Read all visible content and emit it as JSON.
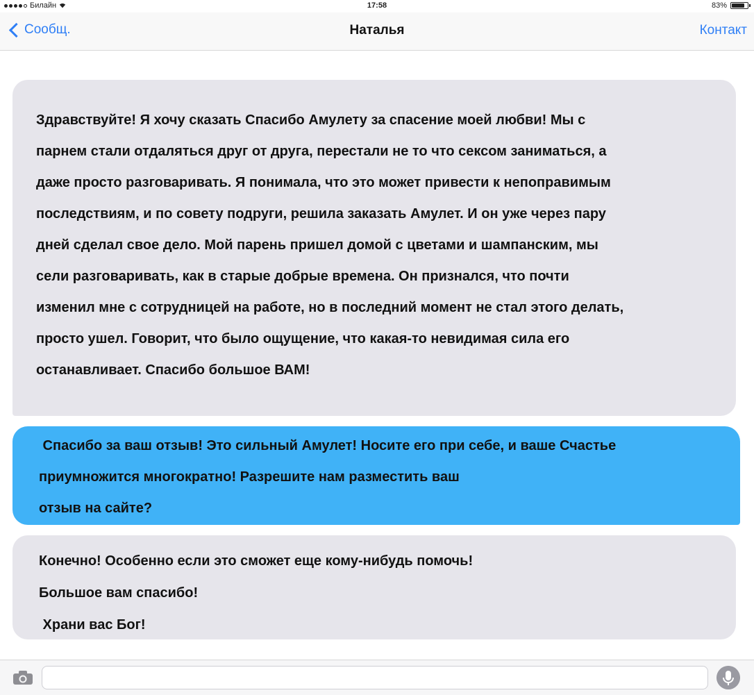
{
  "status_bar": {
    "carrier": "Билайн",
    "time": "17:58",
    "battery_text": "83%",
    "battery_level": 0.83
  },
  "nav": {
    "back_label": "Сообщ.",
    "title": "Наталья",
    "contact_label": "Контакт"
  },
  "messages": [
    {
      "direction": "incoming",
      "lines": [
        "Здравствуйте! Я хочу сказать Спасибо Амулету за спасение моей любви! Мы с",
        "парнем стали отдаляться друг от друга, перестали не то что сексом заниматься, а",
        "даже просто разговаривать. Я понимала, что это может привести к непоправимым",
        "последствиям, и  по совету подруги, решила заказать Амулет. И он уже через пару",
        "дней сделал свое дело. Мой парень пришел домой с цветами и шампанским, мы",
        "сели разговаривать, как в старые добрые времена. Он признался, что почти",
        "изменил мне с сотрудницей на работе, но в последний момент не стал этого делать,",
        "просто ушел. Говорит, что было ощущение, что какая-то невидимая сила его",
        "останавливает. Спасибо большое ВАМ!"
      ]
    },
    {
      "direction": "outgoing",
      "lines": [
        " Спасибо за ваш отзыв! Это сильный Амулет! Носите его при себе, и ваше Счастье",
        "приумножится многократно! Разрешите нам разместить ваш",
        "отзыв на сайте?"
      ]
    },
    {
      "direction": "incoming",
      "lines": [
        "Конечно! Особенно если это сможет еще кому-нибудь помочь!",
        "Большое вам спасибо!",
        " Храни вас Бог!"
      ]
    }
  ],
  "colors": {
    "accent": "#2f7ff6",
    "incoming_bubble": "#e6e5eb",
    "outgoing_bubble": "#40b2f7"
  },
  "icons": {
    "back": "chevron-left-icon",
    "camera": "camera-icon",
    "mic": "microphone-icon",
    "wifi": "wifi-icon",
    "battery": "battery-icon"
  }
}
